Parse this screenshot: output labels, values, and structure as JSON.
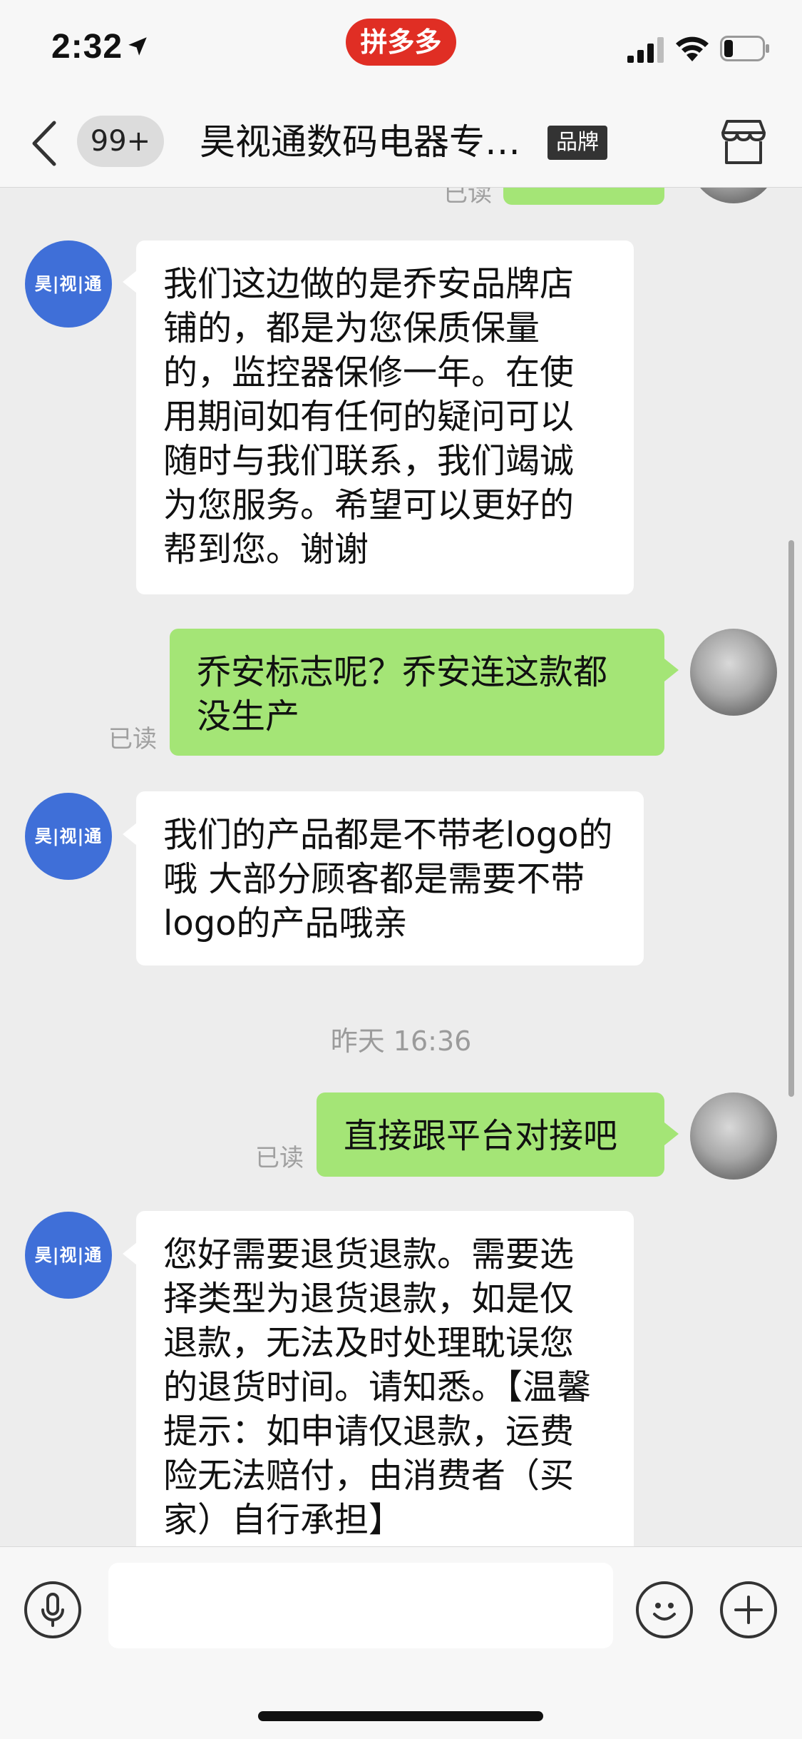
{
  "status_bar": {
    "time": "2:32",
    "app_badge": "拼多多"
  },
  "nav": {
    "unread_count": "99+",
    "title": "昊视通数码电器专…",
    "brand_tag": "品牌"
  },
  "chat": {
    "shop_avatar_text": "昊|视|通",
    "read_label": "已读",
    "time_separator": "昨天 16:36",
    "messages": [
      {
        "side": "left",
        "text": "我们这边做的是乔安品牌店铺的，都是为您保质保量的，监控器保修一年。在使用期间如有任何的疑问可以随时与我们联系，我们竭诚为您服务。希望可以更好的帮到您。谢谢"
      },
      {
        "side": "right",
        "text": "乔安标志呢？乔安连这款都没生产",
        "status": "已读"
      },
      {
        "side": "left",
        "text": "我们的产品都是不带老logo的哦 大部分顾客都是需要不带logo的产品哦亲"
      },
      {
        "side": "right",
        "text": "直接跟平台对接吧",
        "status": "已读"
      },
      {
        "side": "left",
        "text": "您好需要退货退款。需要选择类型为退货退款，如是仅退款，无法及时处理耽误您的退货时间。请知悉。【温馨提示：如申请仅退款，运费险无法赔付，由消费者（买家）自行承担】"
      }
    ]
  },
  "input": {
    "value": "",
    "placeholder": ""
  },
  "colors": {
    "pdd_red": "#e02e24",
    "bubble_green": "#a4e576",
    "shop_avatar_blue": "#3f6fd8"
  }
}
